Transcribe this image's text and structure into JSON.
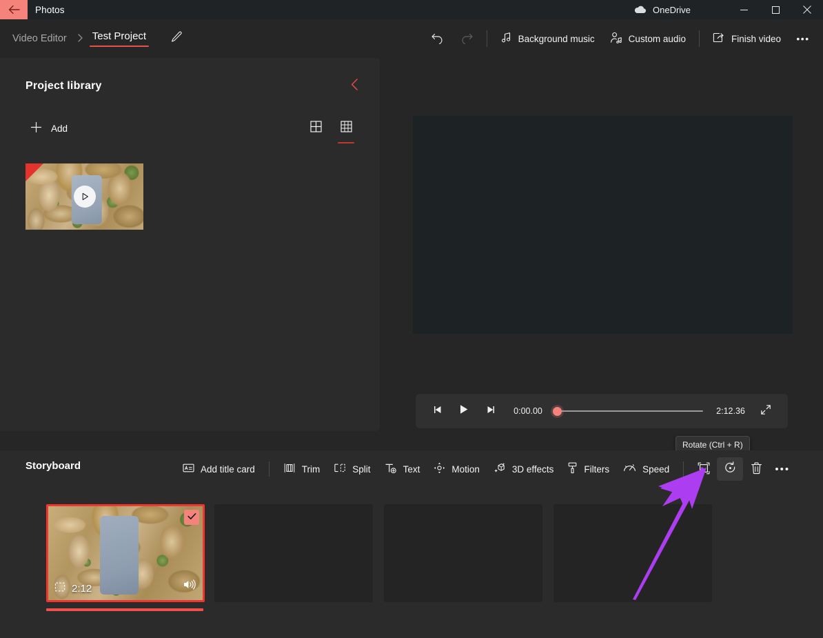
{
  "titlebar": {
    "back_icon": "back-arrow-icon",
    "app_name": "Photos",
    "onedrive_label": "OneDrive",
    "minimize": "—",
    "maximize": "□",
    "close": "✕"
  },
  "header": {
    "breadcrumb_parent": "Video Editor",
    "breadcrumb_separator": "›",
    "breadcrumb_current": "Test Project",
    "rename_icon": "pencil-icon",
    "undo_icon": "undo-icon",
    "redo_icon": "redo-icon",
    "buttons": [
      {
        "label": "Background music",
        "icon": "music-note-icon"
      },
      {
        "label": "Custom audio",
        "icon": "person-audio-icon"
      },
      {
        "label": "Finish video",
        "icon": "share-export-icon"
      }
    ],
    "more_label": "•••"
  },
  "library": {
    "title": "Project library",
    "collapse_icon": "chevron-left-icon",
    "add_label": "Add",
    "add_icon": "plus-icon",
    "view_small_icon": "grid-2x2-icon",
    "view_large_icon": "grid-3x3-icon",
    "active_view": "grid-3x3-icon",
    "item": {
      "name": "video-thumbnail",
      "play_icon": "play-circle-icon"
    }
  },
  "preview": {
    "media_description": "Dry brown fallen leaves with small green sprouts"
  },
  "player": {
    "prev_frame_icon": "previous-frame-icon",
    "play_icon": "play-icon",
    "next_frame_icon": "next-frame-icon",
    "current_time": "0:00.00",
    "total_time": "2:12.36",
    "progress_percent": 0,
    "fullscreen_icon": "expand-icon"
  },
  "storyboard": {
    "title": "Storyboard",
    "tools": [
      {
        "label": "Add title card",
        "icon": "title-card-icon"
      },
      {
        "label": "Trim",
        "icon": "trim-icon"
      },
      {
        "label": "Split",
        "icon": "split-icon"
      },
      {
        "label": "Text",
        "icon": "text-icon"
      },
      {
        "label": "Motion",
        "icon": "motion-icon"
      },
      {
        "label": "3D effects",
        "icon": "cube-sparkle-icon"
      },
      {
        "label": "Filters",
        "icon": "filters-icon"
      },
      {
        "label": "Speed",
        "icon": "speed-gauge-icon"
      }
    ],
    "icon_tools": [
      {
        "name": "crop-resize-icon",
        "hovered": false
      },
      {
        "name": "rotate-icon",
        "hovered": true
      },
      {
        "name": "delete-trash-icon",
        "hovered": false
      },
      {
        "name": "more-ellipsis-icon",
        "hovered": false
      }
    ],
    "tooltip": "Rotate (Ctrl + R)",
    "clips": [
      {
        "type": "video",
        "duration": "2:12",
        "selected": true,
        "has_audio": true,
        "check_icon": "checkmark-icon",
        "frame_icon": "video-frame-icon",
        "volume_icon": "speaker-icon"
      },
      {
        "type": "empty"
      },
      {
        "type": "empty"
      },
      {
        "type": "empty"
      }
    ]
  },
  "annotation": {
    "type": "arrow",
    "color": "#ad3df0",
    "points_to": "rotate-icon"
  },
  "colors": {
    "accent_red": "#e9514b",
    "selection_red": "#f0372f",
    "salmon": "#f4837c",
    "panel_bg": "#2b2b2b",
    "app_bg": "#262626",
    "titlebar_bg": "#1f2326",
    "annotation_purple": "#ad3df0"
  }
}
